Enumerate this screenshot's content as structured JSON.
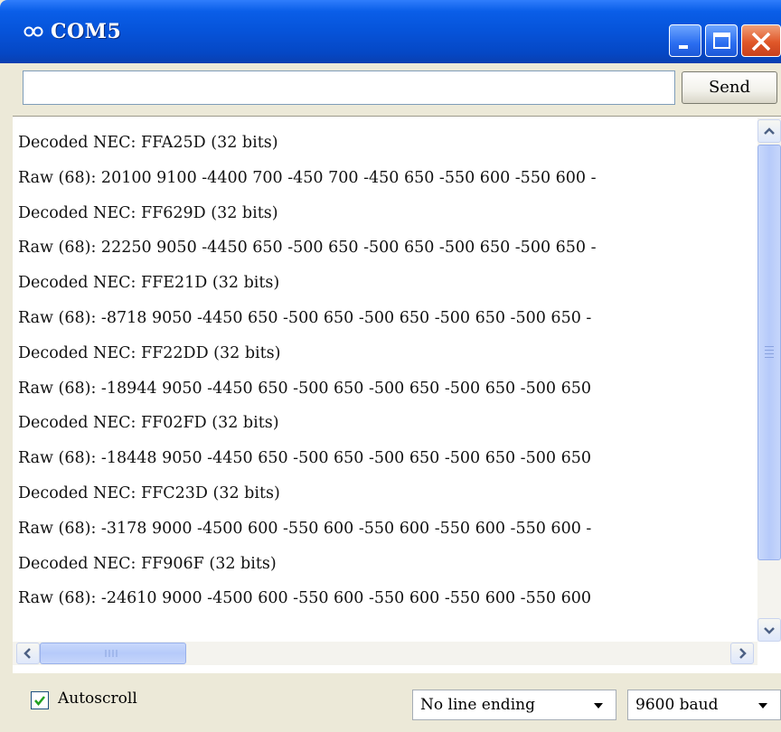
{
  "window": {
    "title": "COM5"
  },
  "send": {
    "input_value": "",
    "button_label": "Send"
  },
  "output": {
    "lines": [
      "Decoded NEC: FFA25D (32 bits)",
      "Raw (68): 20100 9100 -4400 700 -450 700 -450 650 -550 600 -550 600 -",
      "Decoded NEC: FF629D (32 bits)",
      "Raw (68): 22250 9050 -4450 650 -500 650 -500 650 -500 650 -500 650 -",
      "Decoded NEC: FFE21D (32 bits)",
      "Raw (68): -8718 9050 -4450 650 -500 650 -500 650 -500 650 -500 650 -",
      "Decoded NEC: FF22DD (32 bits)",
      "Raw (68): -18944 9050 -4450 650 -500 650 -500 650 -500 650 -500 650",
      "Decoded NEC: FF02FD (32 bits)",
      "Raw (68): -18448 9050 -4450 650 -500 650 -500 650 -500 650 -500 650",
      "Decoded NEC: FFC23D (32 bits)",
      "Raw (68): -3178 9000 -4500 600 -550 600 -550 600 -550 600 -550 600 -",
      "Decoded NEC: FF906F (32 bits)",
      "Raw (68): -24610 9000 -4500 600 -550 600 -550 600 -550 600 -550 600"
    ]
  },
  "footer": {
    "autoscroll_label": "Autoscroll",
    "autoscroll_checked": true,
    "line_ending_selected": "No line ending",
    "baud_selected": "9600 baud"
  },
  "icons": {
    "app": "arduino-infinity-icon",
    "minimize": "minimize-icon",
    "maximize": "maximize-icon",
    "close": "close-icon",
    "scroll_up": "chevron-up-icon",
    "scroll_down": "chevron-down-icon",
    "scroll_left": "chevron-left-icon",
    "scroll_right": "chevron-right-icon",
    "dropdown": "chevron-down-icon",
    "check": "checkmark-icon"
  },
  "colors": {
    "titlebar": "#0653d9",
    "close_button": "#e0582a",
    "window_bg": "#ece9d8"
  }
}
